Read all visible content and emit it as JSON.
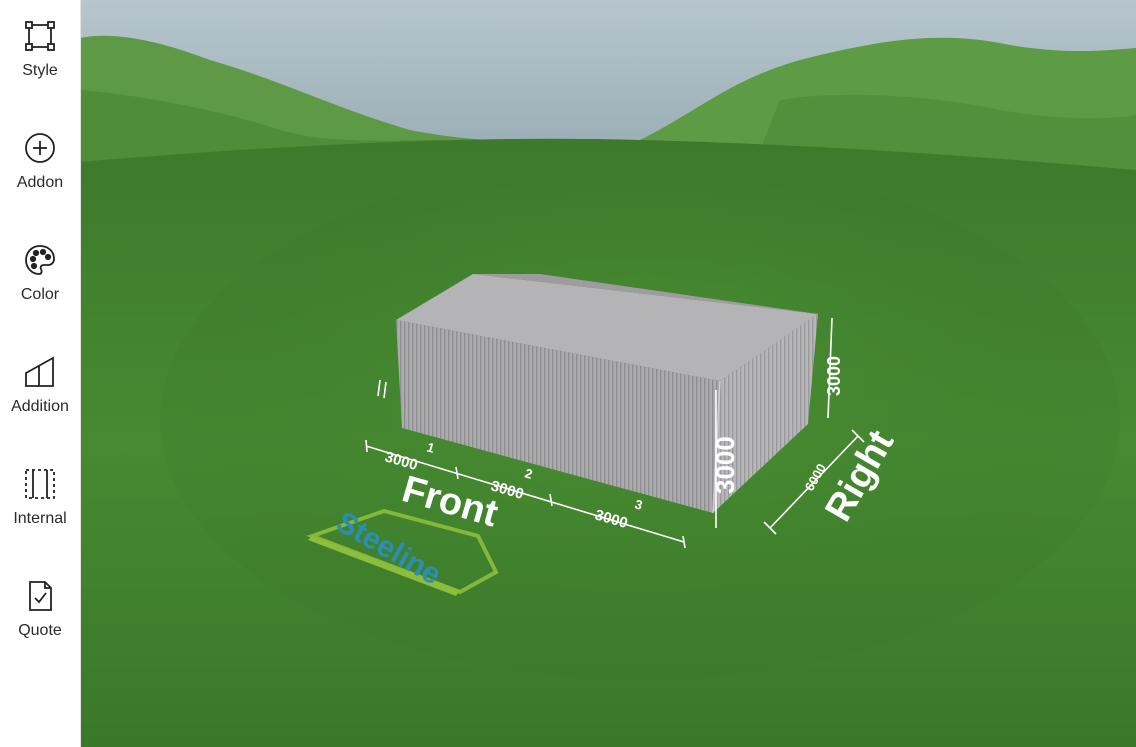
{
  "toolbar": {
    "items": [
      {
        "label": "Style",
        "icon": "style-icon"
      },
      {
        "label": "Addon",
        "icon": "addon-plus-icon"
      },
      {
        "label": "Color",
        "icon": "color-palette-icon"
      },
      {
        "label": "Addition",
        "icon": "addition-icon"
      },
      {
        "label": "Internal",
        "icon": "internal-icon"
      },
      {
        "label": "Quote",
        "icon": "quote-icon"
      }
    ]
  },
  "scene": {
    "logo_text": "Steeline",
    "front_label": "Front",
    "right_label": "Right",
    "bays": [
      {
        "number": "1",
        "width": "3000"
      },
      {
        "number": "2",
        "width": "3000"
      },
      {
        "number": "3",
        "width": "3000"
      }
    ],
    "height_label": "3000",
    "side_height_label": "3000",
    "depth_label": "6000",
    "colors": {
      "grass": "#3f7d2c",
      "sky": "#9fb3bd",
      "shed": "#a9a9ab",
      "logo_blue": "#2a8fb4",
      "logo_green": "#8cbd3c"
    }
  }
}
